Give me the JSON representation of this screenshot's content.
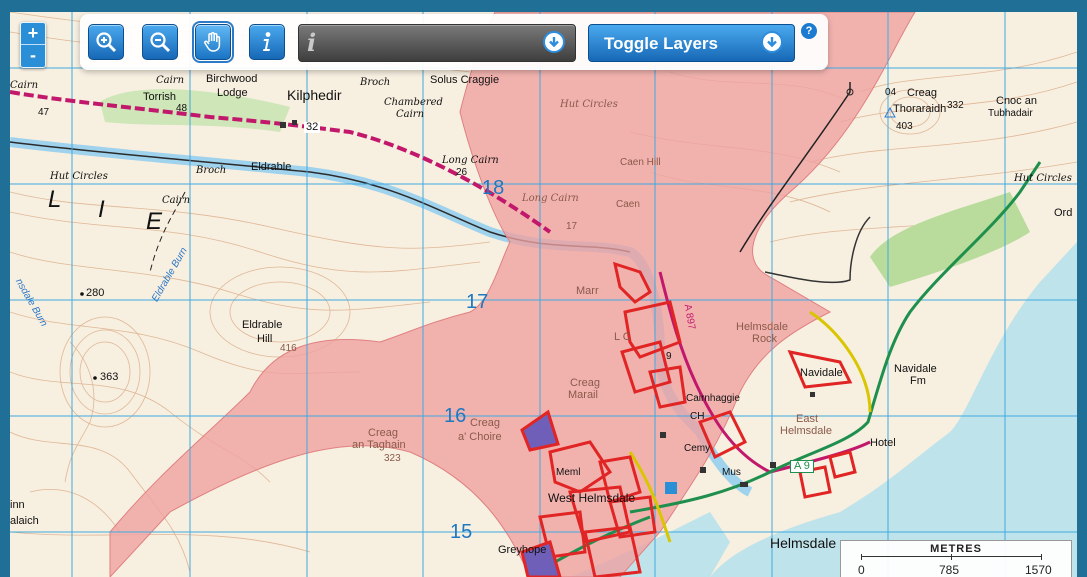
{
  "map": {
    "place_labels": {
      "kilphedir": "Kilphedir",
      "torrish": "Torrish",
      "birchwood_lodge_1": "Birchwood",
      "birchwood_lodge_2": "Lodge",
      "solus_craggie": "Solus Craggie",
      "eldrable": "Eldrable",
      "eldrable_hill_1": "Eldrable",
      "eldrable_hill_2": "Hill",
      "creag_thoraraidh_1": "Creag",
      "creag_thoraraidh_2": "Thoraraidh",
      "cnoc_an_1": "Cnoc an",
      "cnoc_an_2": "Tubhadair",
      "ord": "Ord",
      "helmsdale_rock_1": "Helmsdale",
      "helmsdale_rock_2": "Rock",
      "navidale": "Navidale",
      "navidale_fm_1": "Navidale",
      "navidale_fm_2": "Fm",
      "east_helmsdale_1": "East",
      "east_helmsdale_2": "Helmsdale",
      "hotel": "Hotel",
      "helmsdale": "Helmsdale",
      "west_helmsdale": "West Helmsdale",
      "creag_marail_1": "Creag",
      "creag_marail_2": "Marail",
      "creag_a_choire_1": "Creag",
      "creag_a_choire_2": "a' Choire",
      "creag_an_taghain_1": "Creag",
      "creag_an_taghain_2": "an Taghain",
      "caen_hill": "Caen Hill",
      "caen": "Caen",
      "cairnhaggie": "Cairnhaggie",
      "ch": "CH",
      "cemy": "Cemy",
      "mus": "Mus",
      "meml": "Meml",
      "greyhope": "Greyhope",
      "inn_1": "inn",
      "inn_2": "alaich",
      "l_letter": "L",
      "i_letter": "I",
      "e_letter": "E",
      "ord_num": "04",
      "lc": "L C",
      "marr": "Marr"
    },
    "antiquity_labels": {
      "cairn_1": "Cairn",
      "cairn_2": "Cairn",
      "cairn_3": "Cairn",
      "cairn_4": "Cairn",
      "broch_1": "Broch",
      "broch_2": "Broch",
      "chambered": "Chambered",
      "chambered_2": "Cairn",
      "long_cairn": "Long Cairn",
      "long_cairn_2": "Long Cairn",
      "hut_circles_1": "Hut Circles",
      "hut_circles_2": "Hut Circles",
      "hut_circles_3": "Hut Circles"
    },
    "streams": {
      "eldrable_burn": "Eldrable Burn",
      "nsdale_burn": "nsdale Burn"
    },
    "heights": {
      "h363": "363",
      "h280": "280",
      "h416": "416",
      "h323": "323",
      "h403": "403",
      "h332": "332",
      "h26": "26",
      "h47": "47",
      "h48": "48",
      "h17": "17",
      "h9": "9"
    },
    "grid_numbers": {
      "g18": "18",
      "g17": "17",
      "g16": "16",
      "g15": "15"
    },
    "road_labels": {
      "a9": "A 9",
      "a897": "A 897",
      "r32": "32"
    },
    "colors": {
      "pink_overlay": "#f0a0a0",
      "red_polygons": "#e12424",
      "sea": "#bfe3ea",
      "grid": "#40a8e0",
      "contour": "#d49a6a"
    }
  },
  "controls": {
    "zoom_in": "+",
    "zoom_out": "-",
    "info_italic": "i",
    "toggle_layers": "Toggle Layers",
    "help": "?"
  },
  "scale": {
    "title": "METRES",
    "ticks": [
      "0",
      "785",
      "1570"
    ]
  }
}
